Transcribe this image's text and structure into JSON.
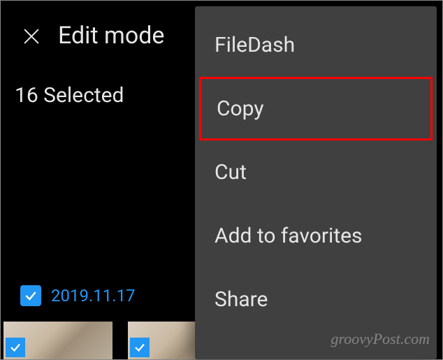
{
  "header": {
    "title": "Edit mode"
  },
  "selection": {
    "count_label": "16 Selected"
  },
  "date_group": {
    "label": "2019.11.17"
  },
  "menu": {
    "items": [
      {
        "label": "FileDash",
        "highlight": false
      },
      {
        "label": "Copy",
        "highlight": true
      },
      {
        "label": "Cut",
        "highlight": false
      },
      {
        "label": "Add to favorites",
        "highlight": false
      },
      {
        "label": "Share",
        "highlight": false
      }
    ]
  },
  "watermark": "groovyPost.com"
}
